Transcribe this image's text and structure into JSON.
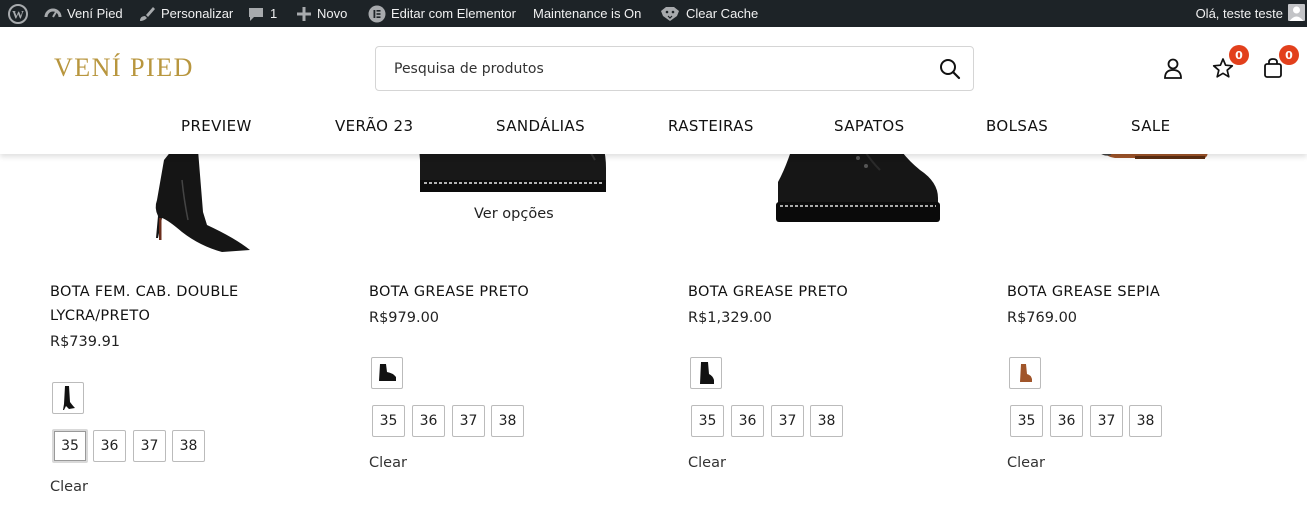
{
  "adminbar": {
    "site_name": "Vení Pied",
    "customize": "Personalizar",
    "comments_count": "1",
    "new": "Novo",
    "edit_elementor": "Editar com Elementor",
    "maintenance": "Maintenance is On",
    "clear_cache": "Clear Cache",
    "greeting": "Olá, teste teste"
  },
  "header": {
    "logo": "VENÍ PIED",
    "search_placeholder": "Pesquisa de produtos",
    "wishlist_count": "0",
    "cart_count": "0",
    "accent_color": "#b8963e",
    "badge_color": "#e2401c"
  },
  "nav": [
    "PREVIEW",
    "VERÃO 23",
    "SANDÁLIAS",
    "RASTEIRAS",
    "SAPATOS",
    "BOLSAS",
    "SALE"
  ],
  "products": [
    {
      "title_line1": "BOTA FEM. CAB. DOUBLE",
      "title_line2": "LYCRA/PRETO",
      "price": "R$739.91",
      "sizes": [
        "35",
        "36",
        "37",
        "38"
      ],
      "selected_size": "35",
      "clear": "Clear"
    },
    {
      "title_line1": "BOTA GREASE PRETO",
      "price": "R$979.00",
      "sizes": [
        "35",
        "36",
        "37",
        "38"
      ],
      "clear": "Clear",
      "overlay": "Ver opções"
    },
    {
      "title_line1": "BOTA GREASE PRETO",
      "price": "R$1,329.00",
      "sizes": [
        "35",
        "36",
        "37",
        "38"
      ],
      "clear": "Clear"
    },
    {
      "title_line1": "BOTA GREASE SEPIA",
      "price": "R$769.00",
      "sizes": [
        "35",
        "36",
        "37",
        "38"
      ],
      "clear": "Clear"
    }
  ]
}
